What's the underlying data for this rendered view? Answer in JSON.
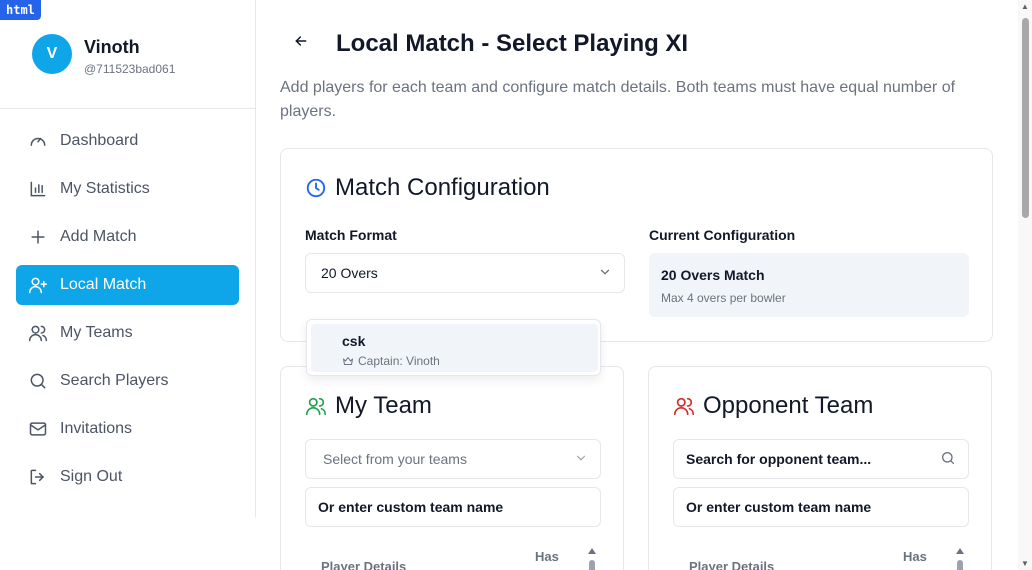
{
  "badge": "html",
  "user": {
    "initial": "V",
    "name": "Vinoth",
    "handle": "@711523bad061"
  },
  "nav": [
    {
      "label": "Dashboard",
      "icon": "gauge-icon"
    },
    {
      "label": "My Statistics",
      "icon": "bar-chart-icon"
    },
    {
      "label": "Add Match",
      "icon": "plus-icon"
    },
    {
      "label": "Local Match",
      "icon": "user-plus-icon",
      "active": true
    },
    {
      "label": "My Teams",
      "icon": "users-icon"
    },
    {
      "label": "Search Players",
      "icon": "search-icon"
    },
    {
      "label": "Invitations",
      "icon": "mail-icon"
    },
    {
      "label": "Sign Out",
      "icon": "sign-out-icon"
    }
  ],
  "page": {
    "title": "Local Match - Select Playing XI",
    "subtitle": "Add players for each team and configure match details. Both teams must have equal number of players."
  },
  "config": {
    "title": "Match Configuration",
    "format_label": "Match Format",
    "format_value": "20 Overs",
    "current_label": "Current Configuration",
    "current_title": "20 Overs Match",
    "current_detail": "Max 4 overs per bowler"
  },
  "dropdown": {
    "name": "csk",
    "captain": "Captain: Vinoth"
  },
  "my_team": {
    "title": "My Team",
    "select_placeholder": "Select from your teams",
    "custom_placeholder": "Or enter custom team name",
    "col_player": "Player Details",
    "col_has": "Has"
  },
  "opponent": {
    "title": "Opponent Team",
    "search_placeholder": "Search for opponent team...",
    "custom_placeholder": "Or enter custom team name",
    "col_player": "Player Details",
    "col_has": "Has"
  },
  "colors": {
    "accent": "#0ea5e9",
    "my_team_icon": "#16a34a",
    "opponent_icon": "#dc2626",
    "config_icon": "#2563eb"
  }
}
